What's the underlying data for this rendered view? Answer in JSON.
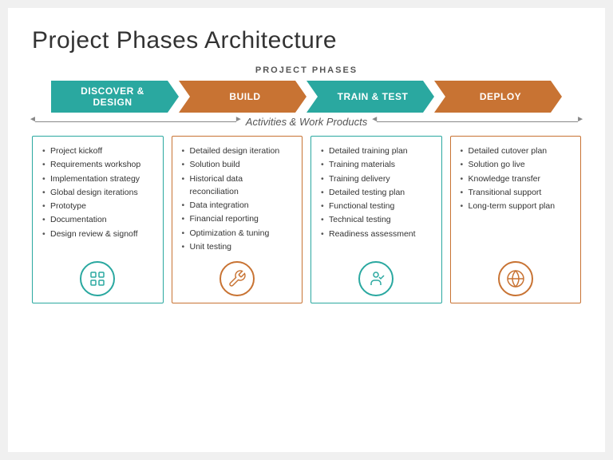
{
  "slide": {
    "main_title": "Project Phases Architecture",
    "phases_label": "PROJECT PHASES",
    "phases": [
      {
        "id": "discover",
        "label": "DISCOVER &\nDESIGN",
        "color": "teal",
        "first": true
      },
      {
        "id": "build",
        "label": "BUILD",
        "color": "orange",
        "first": false
      },
      {
        "id": "train",
        "label": "TRAIN & TEST",
        "color": "teal",
        "first": false
      },
      {
        "id": "deploy",
        "label": "DEPLOY",
        "color": "orange",
        "first": false
      }
    ],
    "activities_label": "Activities & Work Products",
    "columns": [
      {
        "id": "discover-col",
        "border": "teal",
        "icon_type": "teal",
        "items": [
          "Project kickoff",
          "Requirements workshop",
          "Implementation strategy",
          "Global design iterations",
          "Prototype",
          "Documentation",
          "Design review & signoff"
        ]
      },
      {
        "id": "build-col",
        "border": "orange",
        "icon_type": "orange",
        "items": [
          "Detailed design iteration",
          "Solution build",
          "Historical data reconciliation",
          "Data integration",
          "Financial reporting",
          "Optimization & tuning",
          "Unit testing"
        ]
      },
      {
        "id": "train-col",
        "border": "teal",
        "icon_type": "teal",
        "items": [
          "Detailed training plan",
          "Training materials",
          "Training delivery",
          "Detailed testing plan",
          "Functional testing",
          "Technical testing",
          "Readiness assessment"
        ]
      },
      {
        "id": "deploy-col",
        "border": "orange",
        "icon_type": "orange",
        "items": [
          "Detailed cutover plan",
          "Solution go live",
          "Knowledge transfer",
          "Transitional support",
          "Long-term support plan"
        ]
      }
    ]
  }
}
